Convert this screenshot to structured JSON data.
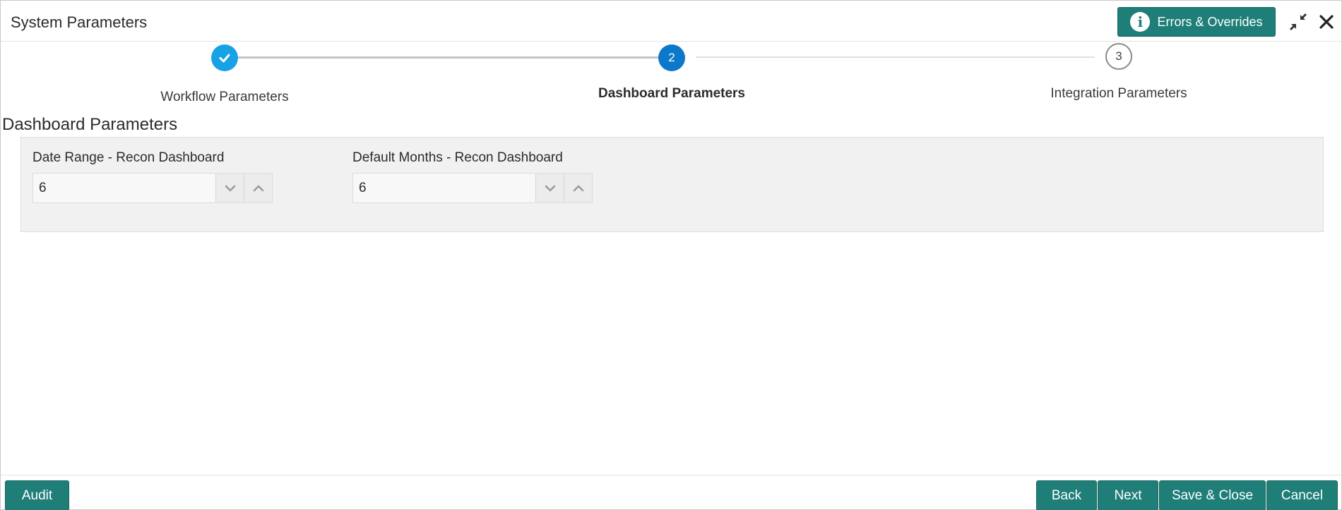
{
  "window": {
    "title": "System Parameters",
    "errors_button": "Errors & Overrides"
  },
  "stepper": {
    "steps": [
      {
        "label": "Workflow Parameters",
        "marker": "",
        "state": "completed"
      },
      {
        "label": "Dashboard Parameters",
        "marker": "2",
        "state": "active"
      },
      {
        "label": "Integration Parameters",
        "marker": "3",
        "state": "pending"
      }
    ]
  },
  "section": {
    "title": "Dashboard Parameters",
    "fields": [
      {
        "label": "Date Range - Recon Dashboard",
        "value": "6"
      },
      {
        "label": "Default Months - Recon Dashboard",
        "value": "6"
      }
    ]
  },
  "footer": {
    "audit": "Audit",
    "back": "Back",
    "next": "Next",
    "save_close": "Save & Close",
    "cancel": "Cancel"
  },
  "colors": {
    "primary_button": "#1f7e78",
    "step_completed": "#17a2e6",
    "step_active": "#0b78c9"
  }
}
